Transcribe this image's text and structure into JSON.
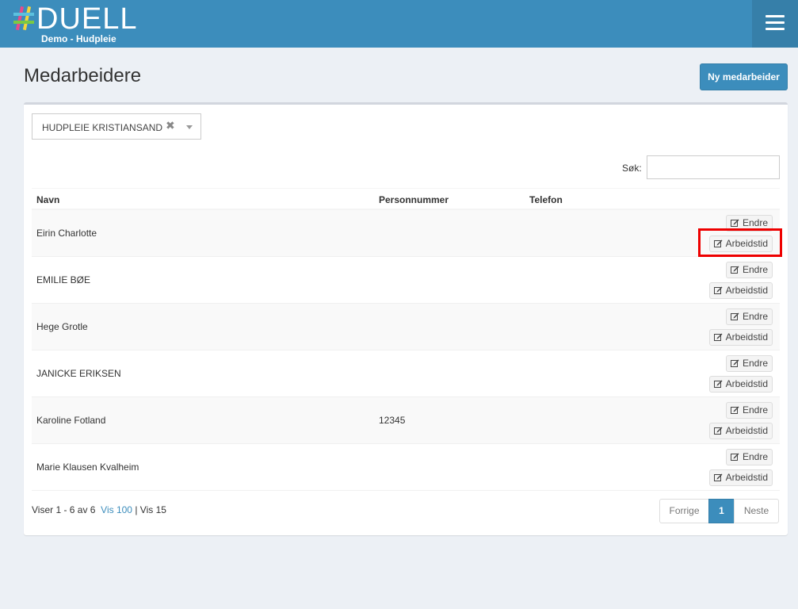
{
  "header": {
    "logo_text": "DUELL",
    "subtitle": "Demo - Hudpleie"
  },
  "icons": {
    "menu": "hamburger-menu-icon",
    "edit": "edit-icon",
    "clear": "close-icon",
    "caret": "caret-down-icon"
  },
  "colors": {
    "header_bg": "#3c8dbc",
    "primary": "#3c8dbc",
    "highlight": "#ee0000"
  },
  "page": {
    "title": "Medarbeidere",
    "new_button": "Ny medarbeider"
  },
  "filter": {
    "selected": "HUDPLEIE KRISTIANSAND",
    "clear_symbol": "✖"
  },
  "search": {
    "label": "Søk:",
    "value": ""
  },
  "table": {
    "columns": [
      "Navn",
      "Personnummer",
      "Telefon"
    ],
    "edit_label": "Endre",
    "worktime_label": "Arbeidstid",
    "rows": [
      {
        "name": "Eirin Charlotte",
        "pnr": "",
        "phone": ""
      },
      {
        "name": "EMILIE BØE",
        "pnr": "",
        "phone": ""
      },
      {
        "name": "Hege Grotle",
        "pnr": "",
        "phone": ""
      },
      {
        "name": "JANICKE ERIKSEN",
        "pnr": "",
        "phone": ""
      },
      {
        "name": "Karoline Fotland",
        "pnr": "12345",
        "phone": ""
      },
      {
        "name": "Marie Klausen Kvalheim",
        "pnr": "",
        "phone": ""
      }
    ]
  },
  "footer": {
    "info": "Viser 1 - 6 av 6",
    "vis100": "Vis 100",
    "separator": "|",
    "vis15": "Vis 15",
    "prev": "Forrige",
    "page": "1",
    "next": "Neste"
  }
}
